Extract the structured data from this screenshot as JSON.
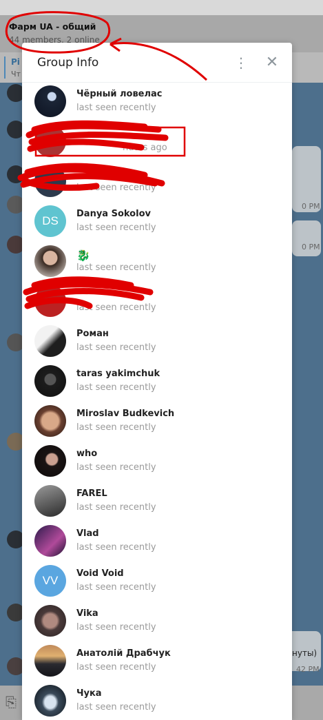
{
  "chat": {
    "title": "Фарм UA - общий",
    "subtitle": "44 members, 2 online",
    "pinned_title": "Pi",
    "pinned_text": "Чт"
  },
  "background_bubbles": {
    "time1": "0 PM",
    "time2": "0 PM",
    "text3": "нуты)",
    "time3": "42 PM"
  },
  "dialog": {
    "title": "Group Info",
    "menu_icon": "more-vertical-icon",
    "close_icon": "close-icon"
  },
  "members": [
    {
      "name": "Чёрный ловелас",
      "status": "last seen recently"
    },
    {
      "name": "",
      "status": "nutes ago"
    },
    {
      "name": "",
      "status": "last seen recently"
    },
    {
      "name": "Danya Sokolov",
      "status": "last seen recently",
      "initials": "DS"
    },
    {
      "name": "🐉",
      "status": "last seen recently"
    },
    {
      "name": "",
      "status": "last seen recently"
    },
    {
      "name": "Роман",
      "status": "last seen recently"
    },
    {
      "name": "taras yakimchuk",
      "status": "last seen recently"
    },
    {
      "name": "Miroslav Budkevich",
      "status": "last seen recently"
    },
    {
      "name": "who",
      "status": "last seen recently"
    },
    {
      "name": "FAREL",
      "status": "last seen recently"
    },
    {
      "name": "Vlad",
      "status": "last seen recently"
    },
    {
      "name": "Void Void",
      "status": "last seen recently",
      "initials": "VV"
    },
    {
      "name": "Vika",
      "status": "last seen recently"
    },
    {
      "name": "Анатолій Драбчук",
      "status": "last seen recently"
    },
    {
      "name": "Чука",
      "status": "last seen recently"
    }
  ],
  "colors": {
    "initials_ds": "#5fc4d0",
    "initials_vv": "#5aa6e0",
    "annotation_red": "#e00000"
  }
}
